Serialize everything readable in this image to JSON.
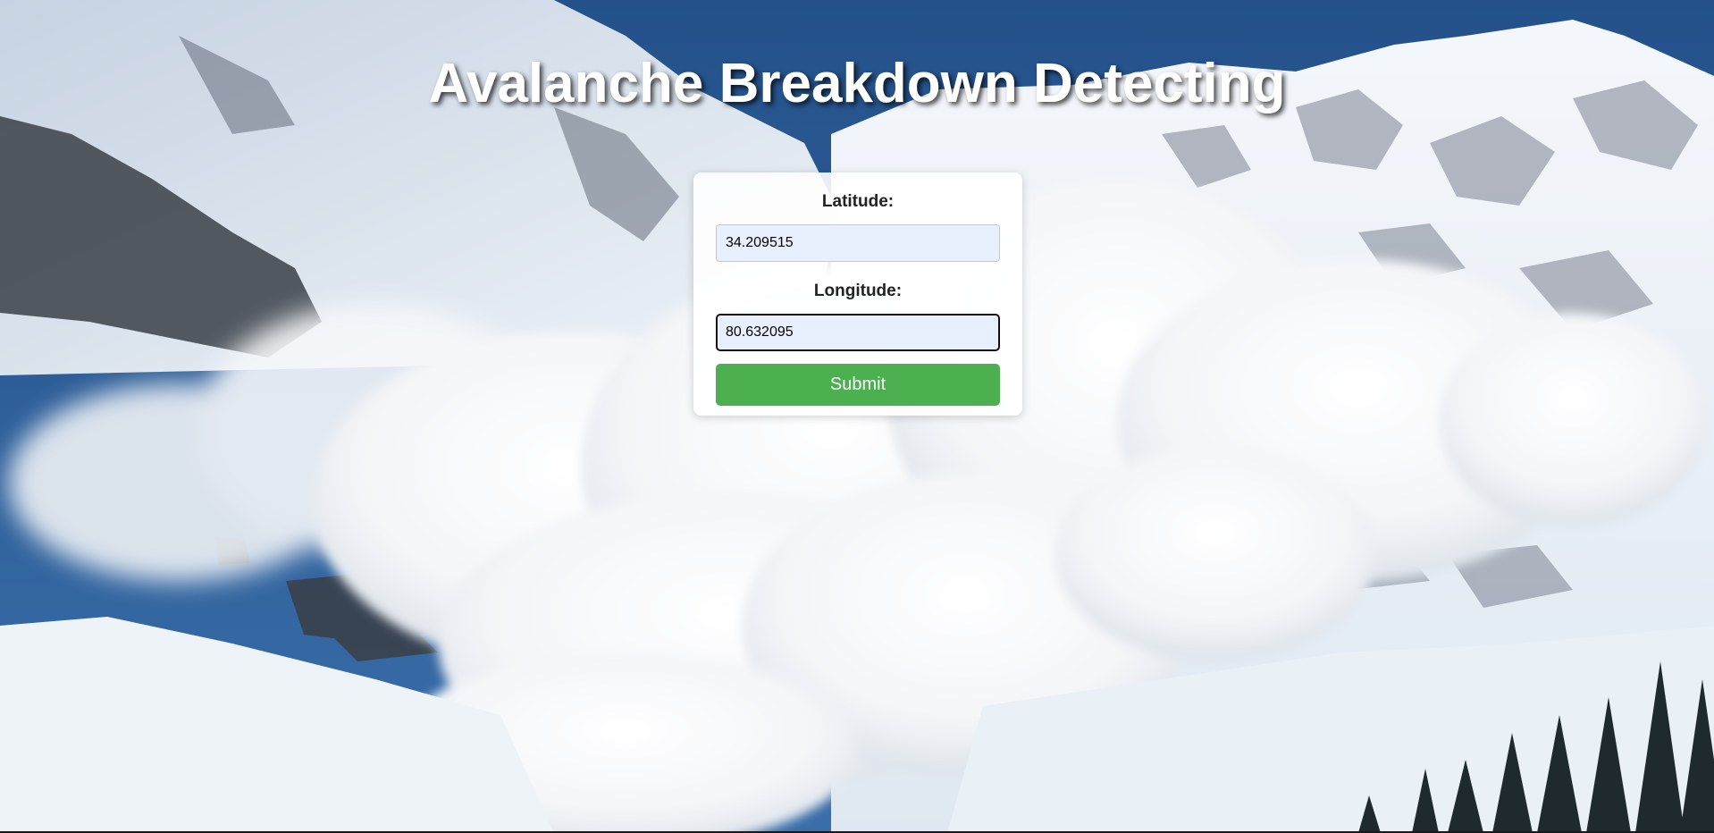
{
  "header": {
    "title": "Avalanche Breakdown Detecting"
  },
  "form": {
    "latitude_label": "Latitude:",
    "latitude_value": "34.209515",
    "longitude_label": "Longitude:",
    "longitude_value": "80.632095",
    "submit_label": "Submit"
  },
  "colors": {
    "sky": "#2a5a93",
    "submit_button": "#4caf50",
    "input_background": "#e8f0fe",
    "title_text": "#ffffff"
  }
}
